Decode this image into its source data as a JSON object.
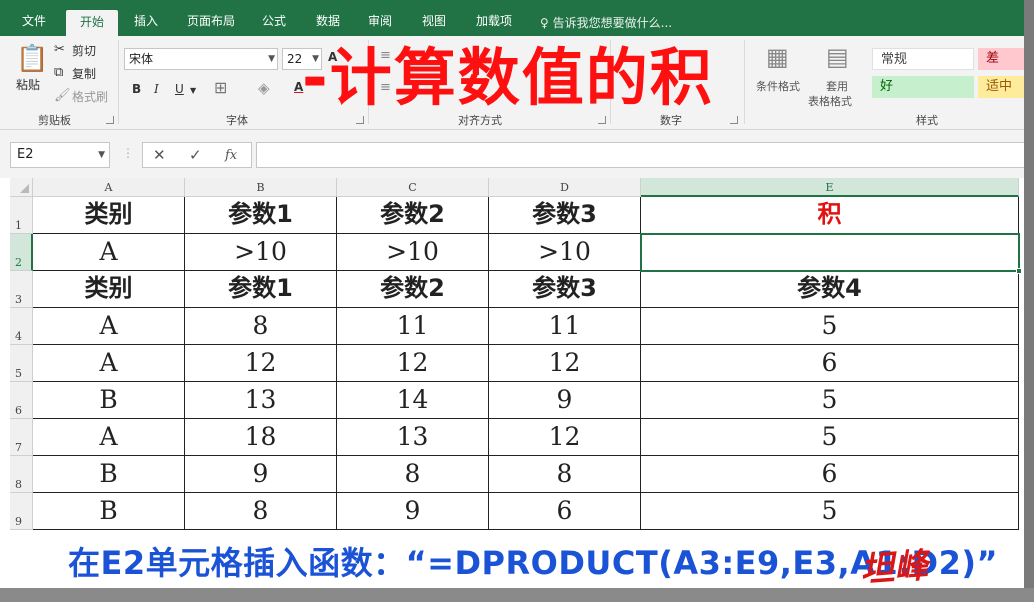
{
  "tabs": [
    {
      "label": "文件"
    },
    {
      "label": "开始"
    },
    {
      "label": "插入"
    },
    {
      "label": "页面布局"
    },
    {
      "label": "公式"
    },
    {
      "label": "数据"
    },
    {
      "label": "审阅"
    },
    {
      "label": "视图"
    },
    {
      "label": "加载项"
    }
  ],
  "tell_me": "告诉我您想要做什么...",
  "clipboard": {
    "paste": "粘贴",
    "cut": "剪切",
    "copy": "复制",
    "format_painter": "格式刷",
    "group": "剪贴板"
  },
  "font": {
    "name": "宋体",
    "size": "22",
    "bold": "B",
    "italic": "I",
    "underline": "U",
    "color_letter": "A",
    "grow_letter": "A",
    "group": "字体"
  },
  "alignment": {
    "group": "对齐方式"
  },
  "number": {
    "group": "数字"
  },
  "styles": {
    "conditional": "条件格式",
    "table_format_line1": "套用",
    "table_format_line2": "表格格式",
    "normal": "常规",
    "bad": "差",
    "good": "好",
    "neutral": "适中",
    "group": "样式",
    "colors": {
      "bad_bg": "#ffc7ce",
      "good_bg": "#c6efce",
      "neutral_bg": "#ffeb9c"
    }
  },
  "overlay_title": "计算数值的积",
  "namebox": "E2",
  "formula_buttons": {
    "cancel": "✕",
    "enter": "✓",
    "fx": "fx"
  },
  "column_headers": [
    "A",
    "B",
    "C",
    "D",
    "E"
  ],
  "row_headers": [
    "1",
    "2",
    "3",
    "4",
    "5",
    "6",
    "7",
    "8",
    "9"
  ],
  "rows": [
    [
      "类别",
      "参数1",
      "参数2",
      "参数3",
      "积"
    ],
    [
      "A",
      ">10",
      ">10",
      ">10",
      ""
    ],
    [
      "类别",
      "参数1",
      "参数2",
      "参数3",
      "参数4"
    ],
    [
      "A",
      "8",
      "11",
      "11",
      "5"
    ],
    [
      "A",
      "12",
      "12",
      "12",
      "6"
    ],
    [
      "B",
      "13",
      "14",
      "9",
      "5"
    ],
    [
      "A",
      "18",
      "13",
      "12",
      "5"
    ],
    [
      "B",
      "9",
      "8",
      "8",
      "6"
    ],
    [
      "B",
      "8",
      "9",
      "6",
      "5"
    ]
  ],
  "caption": "在E2单元格插入函数：“=DPRODUCT(A3:E9,E3,A1:D2)”",
  "signature": "坦峰",
  "colors": {
    "excel_green": "#217346",
    "title_red": "#ff1010",
    "caption_blue": "#1b53d6"
  }
}
